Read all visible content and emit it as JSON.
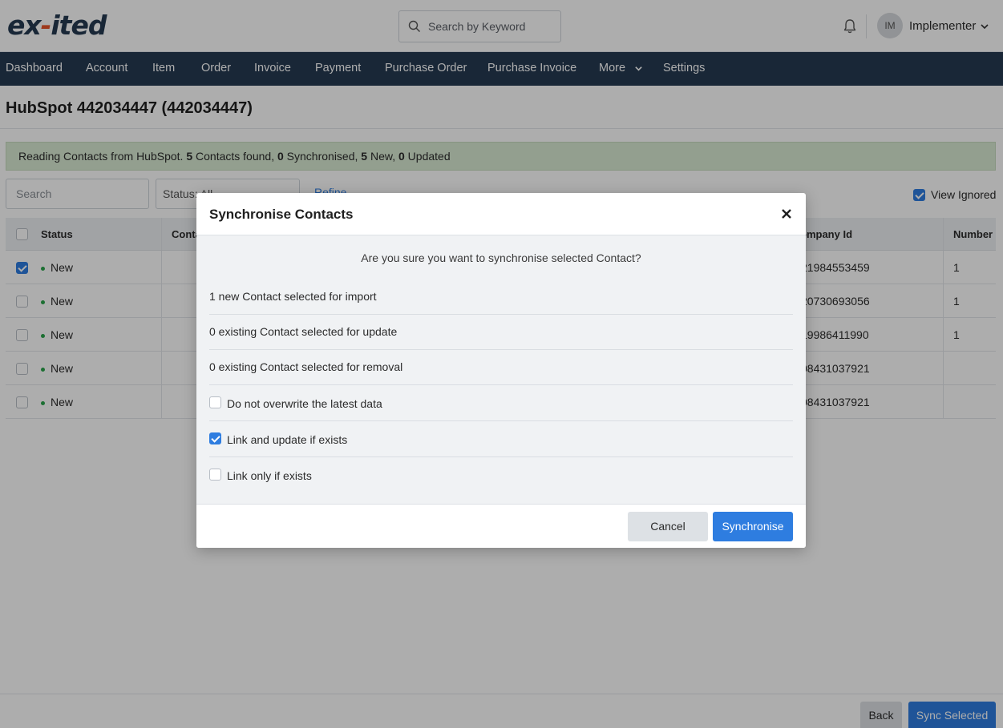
{
  "header": {
    "logo_prefix": "ex",
    "logo_mark": "-",
    "logo_suffix": "ited",
    "search_placeholder": "Search by Keyword",
    "avatar_initials": "IM",
    "user_name": "Implementer"
  },
  "nav": {
    "items": [
      "Dashboard",
      "Account",
      "Item",
      "Order",
      "Invoice",
      "Payment",
      "Purchase Order",
      "Purchase Invoice",
      "More",
      "Settings"
    ]
  },
  "page": {
    "title": "HubSpot 442034447 (442034447)",
    "alert": {
      "prefix": "Reading Contacts from HubSpot.",
      "found_count": "5",
      "found_label": "Contacts found,",
      "sync_count": "0",
      "sync_label": "Synchronised,",
      "new_count": "5",
      "new_label": "New,",
      "updated_count": "0",
      "updated_label": "Updated"
    },
    "search_placeholder": "Search",
    "status_filter": "Status: All",
    "refine_label": "Refine",
    "view_ignored_label": "View Ignored",
    "view_ignored_checked": true
  },
  "table": {
    "headers": [
      "Status",
      "Conta",
      "ompany Id",
      "Number"
    ],
    "rows": [
      {
        "checked": true,
        "status": "New",
        "company_id": "21984553459",
        "number": "1"
      },
      {
        "checked": false,
        "status": "New",
        "company_id": "20730693056",
        "number": "1"
      },
      {
        "checked": false,
        "status": "New",
        "company_id": "19986411990",
        "number": "1"
      },
      {
        "checked": false,
        "status": "New",
        "company_id": "08431037921",
        "number": ""
      },
      {
        "checked": false,
        "status": "New",
        "company_id": "08431037921",
        "number": ""
      }
    ]
  },
  "footer": {
    "back_label": "Back",
    "sync_selected_label": "Sync Selected"
  },
  "modal": {
    "title": "Synchronise Contacts",
    "question": "Are you sure you want to synchronise selected Contact?",
    "summary": [
      "1 new Contact selected for import",
      "0 existing Contact selected for update",
      "0 existing Contact selected for removal"
    ],
    "options": [
      {
        "label": "Do not overwrite the latest data",
        "checked": false
      },
      {
        "label": "Link and update if exists",
        "checked": true
      },
      {
        "label": "Link only if exists",
        "checked": false
      }
    ],
    "cancel_label": "Cancel",
    "confirm_label": "Synchronise"
  },
  "colors": {
    "nav_bg": "#253a52",
    "accent": "#2e7de0",
    "logo_mark": "#e8542c",
    "alert_bg": "#d9ead3",
    "status_dot": "#2aa44a"
  }
}
